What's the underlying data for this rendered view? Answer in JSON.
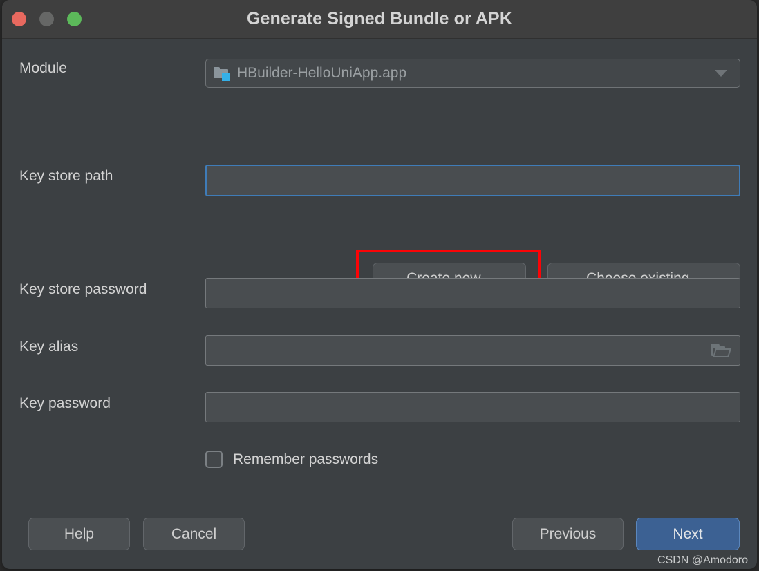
{
  "window": {
    "title": "Generate Signed Bundle or APK",
    "traffic_lights": [
      {
        "name": "close",
        "color": "#e8695f"
      },
      {
        "name": "minimize",
        "color": "#666766"
      },
      {
        "name": "maximize",
        "color": "#5cb95a"
      }
    ]
  },
  "form": {
    "module": {
      "label": "Module",
      "value": "HBuilder-HelloUniApp.app",
      "icon": "module-folder-icon",
      "caret": "chevron-down-icon"
    },
    "key_store_path": {
      "label": "Key store path",
      "value": "",
      "placeholder": "",
      "focused": true
    },
    "create_new_button": "Create new...",
    "choose_existing_button": "Choose existing...",
    "key_store_password": {
      "label": "Key store password",
      "value": "",
      "placeholder": ""
    },
    "key_alias": {
      "label": "Key alias",
      "value": "",
      "placeholder": "",
      "icon": "folder-open-icon"
    },
    "key_password": {
      "label": "Key password",
      "value": "",
      "placeholder": ""
    },
    "remember_passwords": {
      "label": "Remember passwords",
      "checked": false
    }
  },
  "footer": {
    "help": "Help",
    "cancel": "Cancel",
    "previous": "Previous",
    "next": "Next"
  },
  "annotation": {
    "highlight_color": "#fb0407",
    "target": "create-new-button"
  },
  "watermark": "CSDN @Amodoro"
}
